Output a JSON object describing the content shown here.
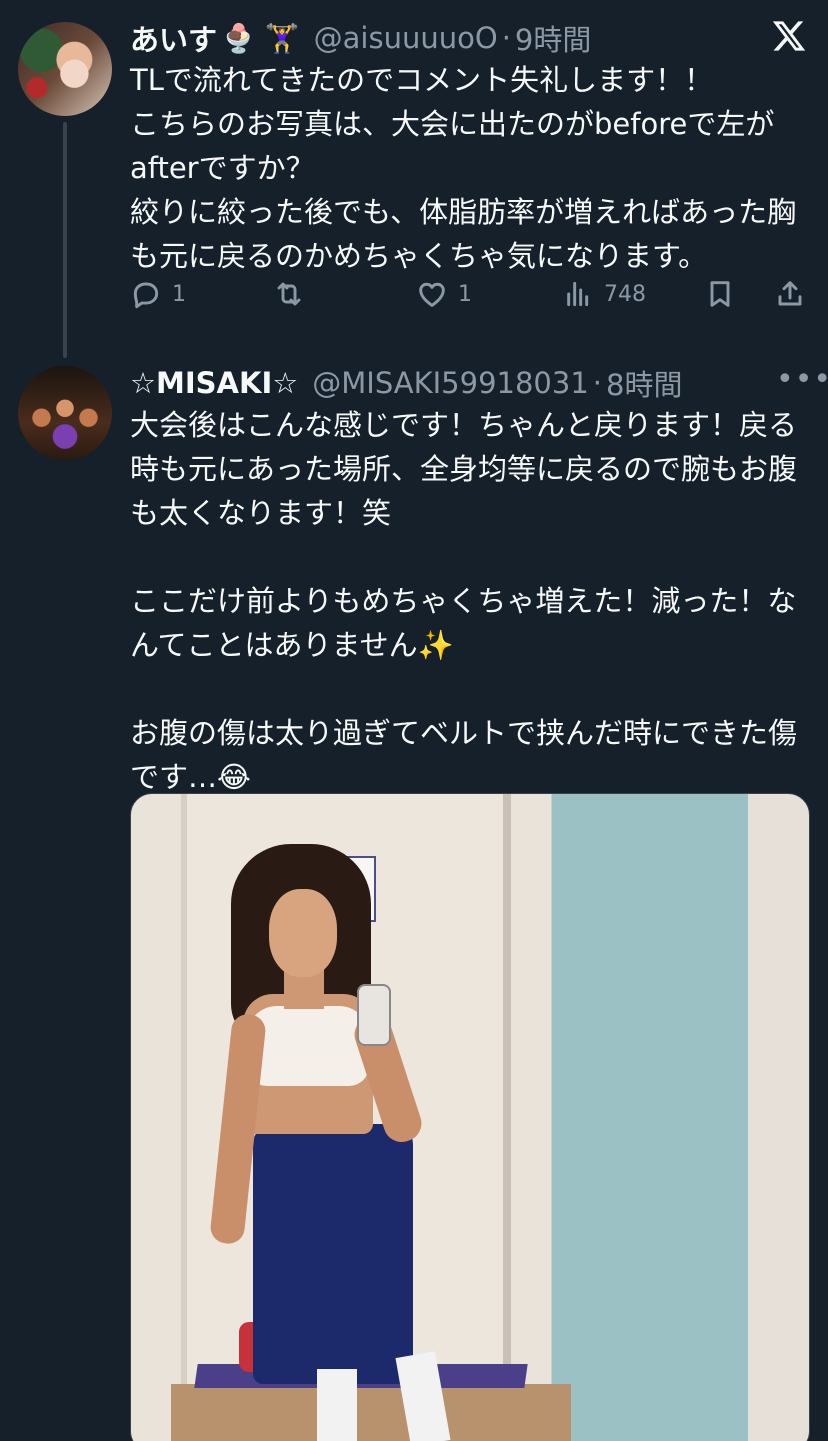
{
  "brand": {
    "logo_icon": "x-logo-icon"
  },
  "tweets": [
    {
      "name": "あいす",
      "emoji": "🍨 🏋️‍♀️",
      "handle": "@aisuuuuoO",
      "separator": "·",
      "time": "9時間",
      "text": "TLで流れてきたのでコメント失礼します！！\nこちらのお写真は、大会に出たのがbeforeで左がafterですか？\n絞りに絞った後でも、体脂肪率が増えればあった胸も元に戻るのかめちゃくちゃ気になります。",
      "actions": {
        "reply": "1",
        "retweet": "",
        "like": "1",
        "views": "748"
      }
    },
    {
      "name": "☆MISAKI☆",
      "handle": "@MISAKI59918031",
      "separator": "·",
      "time": "8時間",
      "more": "•••",
      "text": "大会後はこんな感じです！ちゃんと戻ります！戻る時も元にあった場所、全身均等に戻るので腕もお腹も太くなります！笑\n\nここだけ前よりもめちゃくちゃ増えた！減った！なんてことはありません✨\n\nお腹の傷は太り過ぎてベルトで挟んだ時にできた傷です…😂"
    }
  ],
  "colors": {
    "background": "#15202b",
    "text": "#f7f9f9",
    "muted": "#8b98a5",
    "border": "#38444d"
  }
}
